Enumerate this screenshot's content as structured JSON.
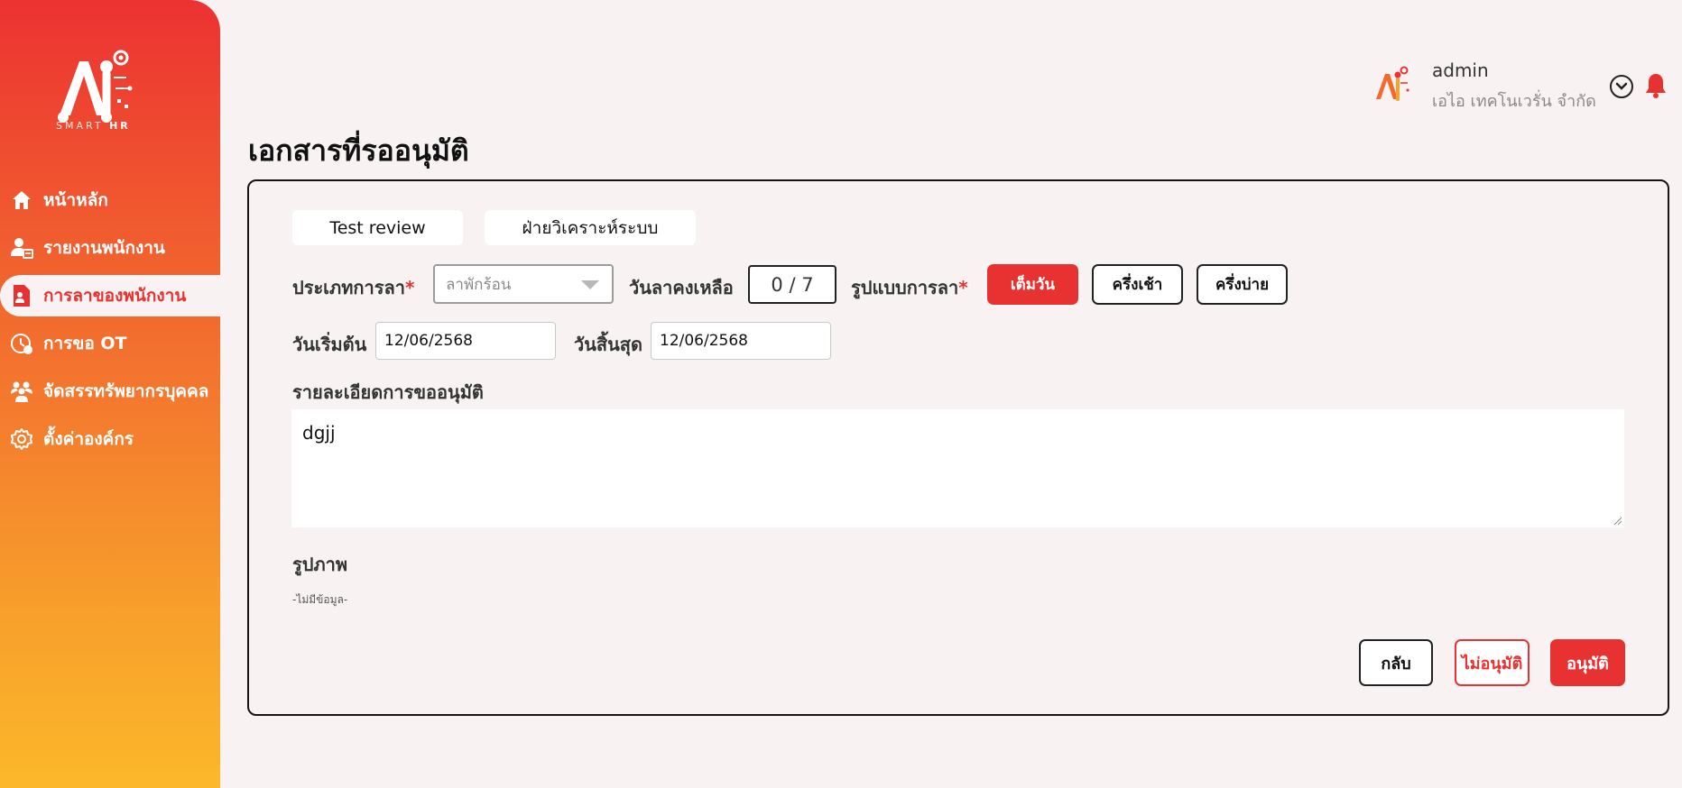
{
  "brand": {
    "logo_text_prefix": "SMART ",
    "logo_text_suffix": "HR"
  },
  "nav": {
    "items": [
      {
        "label": "หน้าหลัก",
        "icon": "home-icon"
      },
      {
        "label": "รายงานพนักงาน",
        "icon": "employee-report-icon"
      },
      {
        "label": "การลาของพนักงาน",
        "icon": "leave-document-icon",
        "active": true
      },
      {
        "label": "การขอ OT",
        "icon": "clock-icon"
      },
      {
        "label": "จัดสรรทรัพยากรบุคคล",
        "icon": "people-group-icon"
      },
      {
        "label": "ตั้งค่าองค์กร",
        "icon": "gear-icon"
      }
    ]
  },
  "header": {
    "user_name": "admin",
    "company": "เอไอ เทคโนเวรั่น จำกัด"
  },
  "page": {
    "title": "เอกสารที่รออนุมัติ"
  },
  "form": {
    "tabs": [
      "Test review",
      "ฝ่ายวิเคราะห์ระบบ"
    ],
    "leave_type_label": "ประเภทการลา",
    "required_mark": "*",
    "leave_type_value": "ลาพักร้อน",
    "remaining_label": "วันลาคงเหลือ",
    "remaining_value": "0 / 7",
    "leave_format_label": "รูปแบบการลา",
    "format_options": [
      "เต็มวัน",
      "ครึ่งเช้า",
      "ครึ่งบ่าย"
    ],
    "start_label": "วันเริ่มต้น",
    "start_value": "12/06/2568",
    "end_label": "วันสิ้นสุด",
    "end_value": "12/06/2568",
    "detail_label": "รายละเอียดการขออนุมัติ",
    "detail_value": "dgjj",
    "image_label": "รูปภาพ",
    "image_empty": "-ไม่มีข้อมูล-"
  },
  "actions": {
    "back": "กลับ",
    "reject": "ไม่อนุมัติ",
    "approve": "อนุมัติ"
  },
  "colors": {
    "accent": "#e83232",
    "sidebar_top": "#ec3232",
    "sidebar_bottom": "#fcb82a"
  }
}
